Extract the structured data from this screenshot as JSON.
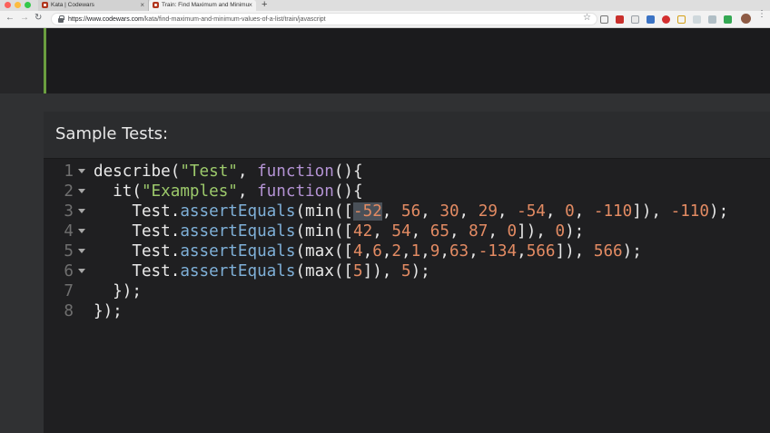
{
  "browser": {
    "tabs": [
      {
        "label": "Kata | Codewars",
        "active": false
      },
      {
        "label": "Train: Find Maximum and Minimu",
        "active": true
      }
    ],
    "new_tab_label": "+",
    "url_host": "https://www.codewars.com",
    "url_path": "/kata/find-maximum-and-minimum-values-of-a-list/train/javascript",
    "extension_icons": [
      "tv-icon",
      "red-extension-icon",
      "translate-icon",
      "blue-extension-icon",
      "opera-icon",
      "lightning-icon",
      "pencil-icon",
      "wand-icon",
      "sheet-icon"
    ]
  },
  "panel": {
    "title": "Sample Tests:"
  },
  "code": {
    "lines": [
      {
        "number": "1",
        "fold": true,
        "tokens": [
          {
            "t": "describe(",
            "c": "txt"
          },
          {
            "t": "\"Test\"",
            "c": "str"
          },
          {
            "t": ", ",
            "c": "txt"
          },
          {
            "t": "function",
            "c": "kw"
          },
          {
            "t": "(){",
            "c": "txt"
          }
        ]
      },
      {
        "number": "2",
        "fold": true,
        "tokens": [
          {
            "t": "  it(",
            "c": "txt"
          },
          {
            "t": "\"Examples\"",
            "c": "str"
          },
          {
            "t": ", ",
            "c": "txt"
          },
          {
            "t": "function",
            "c": "kw"
          },
          {
            "t": "(){",
            "c": "txt"
          }
        ]
      },
      {
        "number": "3",
        "fold": true,
        "tokens": [
          {
            "t": "    Test.",
            "c": "txt"
          },
          {
            "t": "assertEquals",
            "c": "method"
          },
          {
            "t": "(min([",
            "c": "txt"
          },
          {
            "t": "-52",
            "c": "num",
            "sel": true
          },
          {
            "t": ", ",
            "c": "txt"
          },
          {
            "t": "56",
            "c": "num"
          },
          {
            "t": ", ",
            "c": "txt"
          },
          {
            "t": "30",
            "c": "num"
          },
          {
            "t": ", ",
            "c": "txt"
          },
          {
            "t": "29",
            "c": "num"
          },
          {
            "t": ", ",
            "c": "txt"
          },
          {
            "t": "-54",
            "c": "num"
          },
          {
            "t": ", ",
            "c": "txt"
          },
          {
            "t": "0",
            "c": "num"
          },
          {
            "t": ", ",
            "c": "txt"
          },
          {
            "t": "-110",
            "c": "num"
          },
          {
            "t": "]), ",
            "c": "txt"
          },
          {
            "t": "-110",
            "c": "num"
          },
          {
            "t": ");",
            "c": "txt"
          }
        ]
      },
      {
        "number": "4",
        "fold": true,
        "tokens": [
          {
            "t": "    Test.",
            "c": "txt"
          },
          {
            "t": "assertEquals",
            "c": "method"
          },
          {
            "t": "(min([",
            "c": "txt"
          },
          {
            "t": "42",
            "c": "num"
          },
          {
            "t": ", ",
            "c": "txt"
          },
          {
            "t": "54",
            "c": "num"
          },
          {
            "t": ", ",
            "c": "txt"
          },
          {
            "t": "65",
            "c": "num"
          },
          {
            "t": ", ",
            "c": "txt"
          },
          {
            "t": "87",
            "c": "num"
          },
          {
            "t": ", ",
            "c": "txt"
          },
          {
            "t": "0",
            "c": "num"
          },
          {
            "t": "]), ",
            "c": "txt"
          },
          {
            "t": "0",
            "c": "num"
          },
          {
            "t": ");",
            "c": "txt"
          }
        ]
      },
      {
        "number": "5",
        "fold": true,
        "tokens": [
          {
            "t": "    Test.",
            "c": "txt"
          },
          {
            "t": "assertEquals",
            "c": "method"
          },
          {
            "t": "(max([",
            "c": "txt"
          },
          {
            "t": "4",
            "c": "num"
          },
          {
            "t": ",",
            "c": "txt"
          },
          {
            "t": "6",
            "c": "num"
          },
          {
            "t": ",",
            "c": "txt"
          },
          {
            "t": "2",
            "c": "num"
          },
          {
            "t": ",",
            "c": "txt"
          },
          {
            "t": "1",
            "c": "num"
          },
          {
            "t": ",",
            "c": "txt"
          },
          {
            "t": "9",
            "c": "num"
          },
          {
            "t": ",",
            "c": "txt"
          },
          {
            "t": "63",
            "c": "num"
          },
          {
            "t": ",",
            "c": "txt"
          },
          {
            "t": "-134",
            "c": "num"
          },
          {
            "t": ",",
            "c": "txt"
          },
          {
            "t": "566",
            "c": "num"
          },
          {
            "t": "]), ",
            "c": "txt"
          },
          {
            "t": "566",
            "c": "num"
          },
          {
            "t": ");",
            "c": "txt"
          }
        ]
      },
      {
        "number": "6",
        "fold": true,
        "tokens": [
          {
            "t": "    Test.",
            "c": "txt"
          },
          {
            "t": "assertEquals",
            "c": "method"
          },
          {
            "t": "(max([",
            "c": "txt"
          },
          {
            "t": "5",
            "c": "num"
          },
          {
            "t": "]), ",
            "c": "txt"
          },
          {
            "t": "5",
            "c": "num"
          },
          {
            "t": ");",
            "c": "txt"
          }
        ]
      },
      {
        "number": "7",
        "fold": false,
        "tokens": [
          {
            "t": "  });",
            "c": "txt"
          }
        ]
      },
      {
        "number": "8",
        "fold": false,
        "tokens": [
          {
            "t": "});",
            "c": "txt"
          }
        ]
      }
    ]
  },
  "colors": {
    "string": "#9cc96b",
    "keyword": "#b493d4",
    "method": "#7fb0d8",
    "number": "#e38b63",
    "text": "#e8e8e8",
    "editor_accent": "#6a9e3f"
  }
}
